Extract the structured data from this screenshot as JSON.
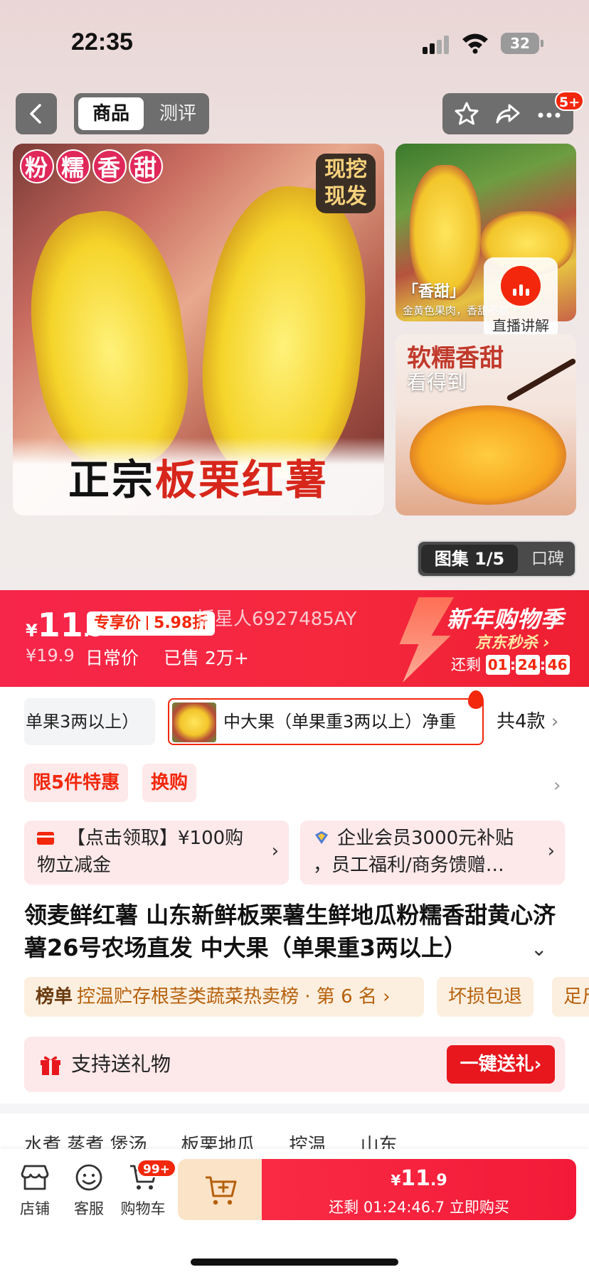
{
  "status_bar": {
    "time": "22:35",
    "battery": "32"
  },
  "nav": {
    "tab_product": "商品",
    "tab_review": "测评",
    "more_badge": "5+"
  },
  "gallery": {
    "main_tag": [
      "粉",
      "糯",
      "香",
      "甜"
    ],
    "main_badge": "现挖现发",
    "main_caption_black": "正宗",
    "main_caption_red": "板栗红薯",
    "side1_label": "「香甜」",
    "side1_sub": "金黄色果肉，香甜不腻",
    "side2_title": "软糯香甜",
    "side2_sub": "看得到",
    "live_label": "直播讲解",
    "album_label": "图集 1/5",
    "review_label": "口碑"
  },
  "price": {
    "currency": "¥",
    "integer": "11",
    "decimal": ".9",
    "tag_left": "专享价",
    "tag_right": "5.98折",
    "watermark": "摇星人6927485AY",
    "original": "¥19.9",
    "daily_label": "日常价",
    "sold": "已售 2万+",
    "festival_title": "新年购物季",
    "festival_sub": "京东秒杀 ›",
    "countdown_label": "还剩",
    "countdown": [
      "01",
      "24",
      "46"
    ]
  },
  "variants": {
    "option1": "单果3两以上）",
    "option2": "中大果（单果重3两以上）净重",
    "total": "共4款"
  },
  "promos": {
    "tag1": "限5件特惠",
    "tag2": "换购"
  },
  "coupons": [
    {
      "line1": "【点击领取】¥100购",
      "line2": "物立减金"
    },
    {
      "line1": "企业会员3000元补贴",
      "line2": "，员工福利/商务馈赠…"
    }
  ],
  "product": {
    "title": "领麦鲜红薯  山东新鲜板栗薯生鲜地瓜粉糯香甜黄心济薯26号农场直发 中大果（单果重3两以上）"
  },
  "ranking": {
    "label": "榜单",
    "text": "控温贮存根茎类蔬菜热卖榜 · 第 6 名 ›",
    "tag1": "坏损包退",
    "tag2": "足斤"
  },
  "gift": {
    "text": "支持送礼物",
    "button": "一键送礼›"
  },
  "attr_tags": [
    "水煮 蒸煮 煲汤",
    "板栗地瓜",
    "控温",
    "山东"
  ],
  "bottom": {
    "store": "店铺",
    "service": "客服",
    "cart": "购物车",
    "cart_badge": "99+",
    "buy_price_currency": "¥",
    "buy_price_int": "11",
    "buy_price_dec": ".9",
    "buy_sub": "还剩 01:24:46.7 立即购买"
  },
  "colors": {
    "accent": "#f2270c",
    "price_bar": "#f6254a",
    "rank_bg": "#fcefdf"
  }
}
